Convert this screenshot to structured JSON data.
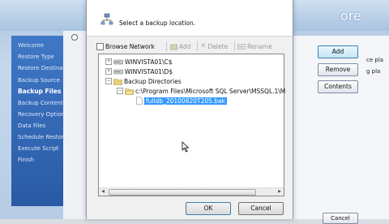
{
  "background": {
    "heading": "ore",
    "nav_items": [
      {
        "label": "Welcome",
        "active": false
      },
      {
        "label": "Restore Type",
        "active": false
      },
      {
        "label": "Restore Destinati",
        "active": false
      },
      {
        "label": "Backup Source",
        "active": false
      },
      {
        "label": "Backup Files",
        "active": true
      },
      {
        "label": "Backup Contents",
        "active": false
      },
      {
        "label": "Recovery Options",
        "active": false
      },
      {
        "label": "Data Files",
        "active": false
      },
      {
        "label": "Schedule Restore",
        "active": false
      },
      {
        "label": "Execute Script",
        "active": false
      },
      {
        "label": "Finish",
        "active": false
      }
    ],
    "buttons": {
      "add": "Add",
      "remove": "Remove",
      "contents": "Contents",
      "cancel": "Cancel"
    },
    "side_texts": [
      "ce pla",
      "g pla"
    ]
  },
  "dialog": {
    "title": "Select a backup location.",
    "toolbar": {
      "browse_network": "Browse Network",
      "add": "Add",
      "delete": "Delete",
      "rename": "Rename"
    },
    "tree": [
      {
        "label": "WINVISTA01\\C$",
        "expander": "+",
        "icon": "drive-icon"
      },
      {
        "label": "WINVISTA01\\D$",
        "expander": "+",
        "icon": "drive-icon"
      },
      {
        "label": "Backup Directories",
        "expander": "−",
        "icon": "folder-icon"
      },
      {
        "label": "c:\\Program Files\\Microsoft SQL Server\\MSSQL.1\\M",
        "expander": "−",
        "icon": "folder-icon"
      },
      {
        "label": "fulldb_20100820T205.bak",
        "icon": "file-icon",
        "selected": true
      }
    ],
    "ok": "OK",
    "cancel": "Cancel"
  },
  "colors": {
    "selection": "#3399ff",
    "nav": "#2f66b4"
  }
}
